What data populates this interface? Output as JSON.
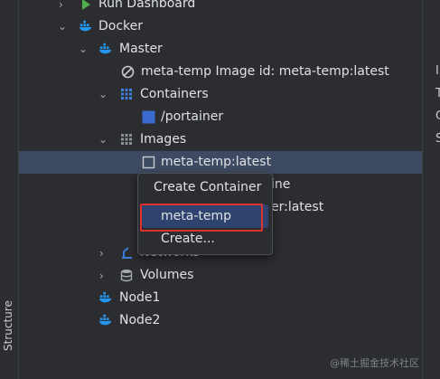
{
  "tree": {
    "run_dashboard": "Run Dashboard",
    "docker": "Docker",
    "master": "Master",
    "image_line": "meta-temp Image id: meta-temp:latest",
    "containers": "Containers",
    "portainer": "/portainer",
    "images": "Images",
    "image_selected": "meta-temp:latest",
    "image_row2_tail": "ine",
    "image_row3_tail": "er:latest",
    "networks": "Networks",
    "volumes": "Volumes",
    "node1": "Node1",
    "node2": "Node2"
  },
  "context_menu": {
    "items": [
      "Create Container",
      "meta-temp",
      "Create..."
    ],
    "highlighted": "meta-temp"
  },
  "left_toolbar": {
    "structure_label": "Structure"
  },
  "right_panel_cut_letters": [
    "I",
    "T",
    "C",
    "S"
  ],
  "watermark": "@稀土掘金技术社区",
  "colors": {
    "selection": "#3d4a61",
    "menu_highlight": "#2e436e",
    "annotation_red": "#e0322c",
    "docker_blue": "#2496ed",
    "run_green": "#4fb04a"
  }
}
